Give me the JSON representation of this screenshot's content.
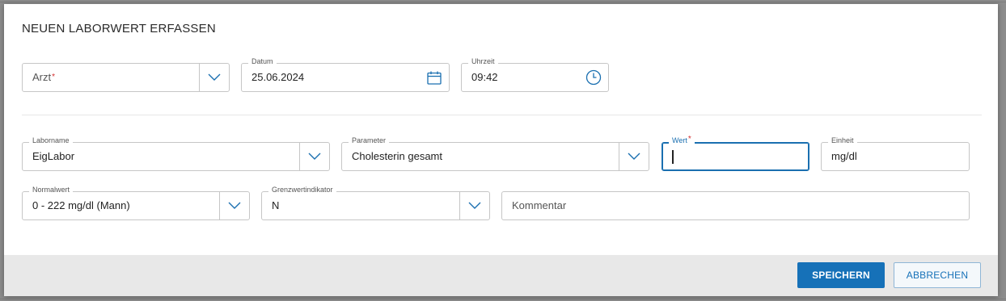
{
  "dialog": {
    "title": "NEUEN LABORWERT ERFASSEN"
  },
  "arzt": {
    "placeholder": "Arzt",
    "required_mark": "*"
  },
  "datum": {
    "label": "Datum",
    "value": "25.06.2024"
  },
  "uhrzeit": {
    "label": "Uhrzeit",
    "value": "09:42"
  },
  "laborname": {
    "label": "Laborname",
    "value": "EigLabor"
  },
  "parameter": {
    "label": "Parameter",
    "value": "Cholesterin gesamt"
  },
  "wert": {
    "label": "Wert",
    "required_mark": "*",
    "value": ""
  },
  "einheit": {
    "label": "Einheit",
    "value": "mg/dl"
  },
  "normalwert": {
    "label": "Normalwert",
    "value": "0 - 222 mg/dl (Mann)"
  },
  "grenzwert": {
    "label": "Grenzwertindikator",
    "value": "N"
  },
  "kommentar": {
    "placeholder": "Kommentar"
  },
  "footer": {
    "save_label": "SPEICHERN",
    "cancel_label": "ABBRECHEN"
  },
  "colors": {
    "accent": "#1671b8",
    "required": "#d32f2f",
    "border": "#c6c6c6",
    "footer_bg": "#e8e8e8"
  },
  "icons": {
    "dropdown": "chevron-down-icon",
    "date": "calendar-icon",
    "time": "clock-icon"
  }
}
